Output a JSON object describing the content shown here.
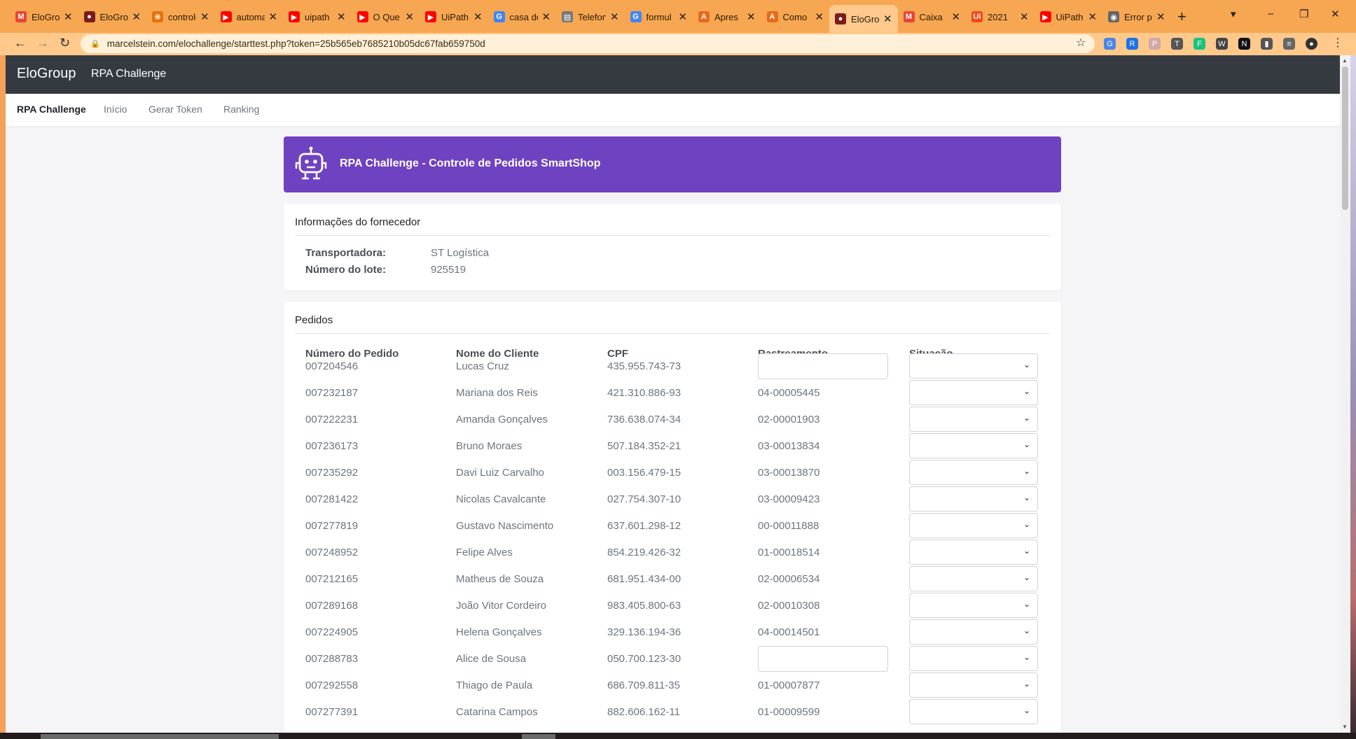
{
  "browser": {
    "tabs": [
      {
        "label": "EloGroup",
        "fav": "gmail",
        "color": "#ea4335"
      },
      {
        "label": "EloGroup",
        "fav": "elo",
        "color": "#7a1c1c"
      },
      {
        "label": "controle",
        "fav": "dots",
        "color": "#e8710a"
      },
      {
        "label": "automação",
        "fav": "youtube",
        "color": "#ff0000"
      },
      {
        "label": "uipath",
        "fav": "youtube",
        "color": "#ff0000"
      },
      {
        "label": "O Que",
        "fav": "youtube",
        "color": "#ff0000"
      },
      {
        "label": "UiPath",
        "fav": "youtube",
        "color": "#ff0000"
      },
      {
        "label": "casa de",
        "fav": "google",
        "color": "#4285f4"
      },
      {
        "label": "Telefone",
        "fav": "doc",
        "color": "#777777"
      },
      {
        "label": "formul",
        "fav": "google",
        "color": "#4285f4"
      },
      {
        "label": "Apres",
        "fav": "a",
        "color": "#e86a1a"
      },
      {
        "label": "Como",
        "fav": "a",
        "color": "#e86a1a"
      },
      {
        "label": "EloGroup",
        "fav": "elo",
        "color": "#7a1c1c"
      },
      {
        "label": "Caixa",
        "fav": "gmail",
        "color": "#ea4335"
      },
      {
        "label": "2021",
        "fav": "ui",
        "color": "#fa4616"
      },
      {
        "label": "UiPath",
        "fav": "youtube",
        "color": "#ff0000"
      },
      {
        "label": "Error p",
        "fav": "globe",
        "color": "#666666"
      }
    ],
    "active_tab": 12,
    "url": "marcelstein.com/elochallenge/starttest.php?token=25b565eb7685210b05dc67fab659750d"
  },
  "navbar": {
    "brand": "EloGroup",
    "subtitle": "RPA Challenge"
  },
  "subnav": {
    "items": [
      "RPA Challenge",
      "Início",
      "Gerar Token",
      "Ranking"
    ],
    "active": 0
  },
  "banner": {
    "title": "RPA Challenge - Controle de Pedidos SmartShop"
  },
  "supplier": {
    "heading": "Informações do fornecedor",
    "carrier_label": "Transportadora:",
    "carrier_value": "ST Logística",
    "batch_label": "Número do lote:",
    "batch_value": "925519"
  },
  "orders": {
    "heading": "Pedidos",
    "columns": [
      "Número do Pedido",
      "Nome do Cliente",
      "CPF",
      "Rastreamento",
      "Situação"
    ],
    "rows": [
      {
        "order": "007204546",
        "name": "Lucas Cruz",
        "cpf": "435.955.743-73",
        "tracking": "",
        "tracking_input": true
      },
      {
        "order": "007232187",
        "name": "Mariana dos Reis",
        "cpf": "421.310.886-93",
        "tracking": "04-00005445",
        "tracking_input": false
      },
      {
        "order": "007222231",
        "name": "Amanda Gonçalves",
        "cpf": "736.638.074-34",
        "tracking": "02-00001903",
        "tracking_input": false
      },
      {
        "order": "007236173",
        "name": "Bruno Moraes",
        "cpf": "507.184.352-21",
        "tracking": "03-00013834",
        "tracking_input": false
      },
      {
        "order": "007235292",
        "name": "Davi Luiz Carvalho",
        "cpf": "003.156.479-15",
        "tracking": "03-00013870",
        "tracking_input": false
      },
      {
        "order": "007281422",
        "name": "Nicolas Cavalcante",
        "cpf": "027.754.307-10",
        "tracking": "03-00009423",
        "tracking_input": false
      },
      {
        "order": "007277819",
        "name": "Gustavo Nascimento",
        "cpf": "637.601.298-12",
        "tracking": "00-00011888",
        "tracking_input": false
      },
      {
        "order": "007248952",
        "name": "Felipe Alves",
        "cpf": "854.219.426-32",
        "tracking": "01-00018514",
        "tracking_input": false
      },
      {
        "order": "007212165",
        "name": "Matheus de Souza",
        "cpf": "681.951.434-00",
        "tracking": "02-00006534",
        "tracking_input": false
      },
      {
        "order": "007289168",
        "name": "João Vitor Cordeiro",
        "cpf": "983.405.800-63",
        "tracking": "02-00010308",
        "tracking_input": false
      },
      {
        "order": "007224905",
        "name": "Helena Gonçalves",
        "cpf": "329.136.194-36",
        "tracking": "04-00014501",
        "tracking_input": false
      },
      {
        "order": "007288783",
        "name": "Alice de Sousa",
        "cpf": "050.700.123-30",
        "tracking": "",
        "tracking_input": true
      },
      {
        "order": "007292558",
        "name": "Thiago de Paula",
        "cpf": "686.709.811-35",
        "tracking": "01-00007877",
        "tracking_input": false
      },
      {
        "order": "007277391",
        "name": "Catarina Campos",
        "cpf": "882.606.162-11",
        "tracking": "01-00009599",
        "tracking_input": false
      }
    ]
  },
  "colors": {
    "navbar": "#343a40",
    "banner": "#6f42c1",
    "chrome_tabs": "#f7a751",
    "chrome_toolbar": "#ffc98c"
  },
  "icons": [
    "back-arrow-icon",
    "forward-arrow-icon",
    "reload-icon",
    "lock-icon",
    "star-icon",
    "robot-icon",
    "chevron-down-icon",
    "close-icon",
    "plus-icon"
  ]
}
